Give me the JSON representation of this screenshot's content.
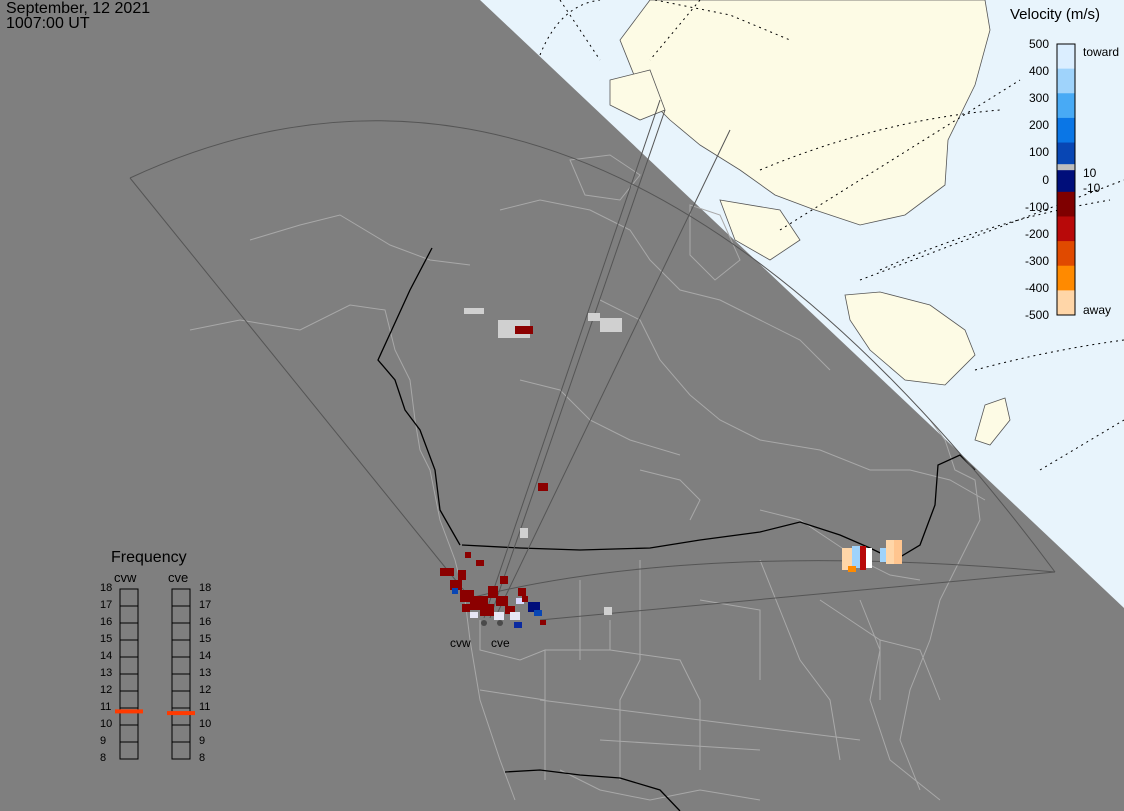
{
  "header": {
    "date": "September, 12 2021",
    "time": "1007:00 UT"
  },
  "colorbar": {
    "title": "Velocity (m/s)",
    "ticks": [
      "500",
      "400",
      "300",
      "200",
      "100",
      "0",
      "-100",
      "-200",
      "-300",
      "-400",
      "-500"
    ],
    "toward_label": "toward",
    "away_label": "away",
    "threshold_pos": "10",
    "threshold_neg": "-10",
    "colors": [
      "#dbeeff",
      "#9fd3fb",
      "#48aaf5",
      "#0a76e6",
      "#0846b4",
      "#000e7a",
      "#7f0000",
      "#b80909",
      "#e04a00",
      "#ff8a00",
      "#ffd6a8"
    ]
  },
  "frequency": {
    "title": "Frequency",
    "columns": [
      {
        "name": "cvw",
        "value": 10.8
      },
      {
        "name": "cve",
        "value": 10.7
      }
    ],
    "scale": [
      "18",
      "17",
      "16",
      "15",
      "14",
      "13",
      "12",
      "11",
      "10",
      "9",
      "8"
    ],
    "indicator_color": "#ff3a00"
  },
  "sites": [
    "cvw",
    "cve"
  ],
  "map_colors": {
    "night": "#7f7f7f",
    "ocean": "#e8f4fc",
    "land": "#fdfbe5",
    "border": "#000000",
    "coast": "#a8a8a8"
  }
}
